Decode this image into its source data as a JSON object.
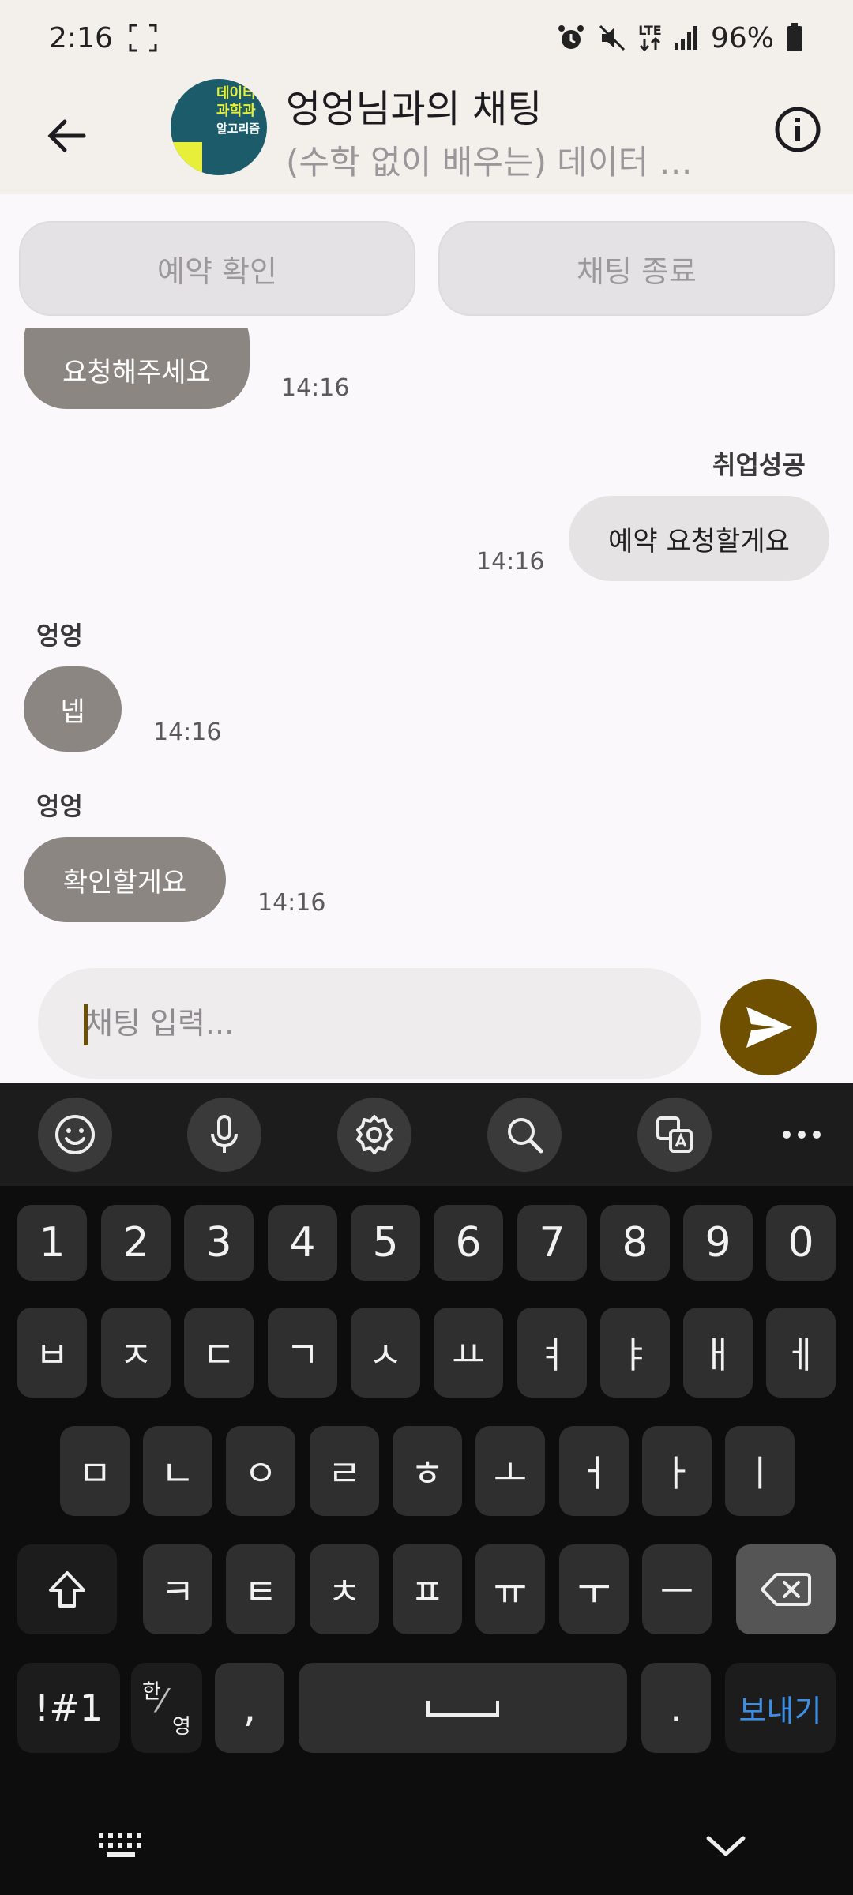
{
  "status_bar": {
    "time": "2:16",
    "network": "LTE",
    "battery": "96%",
    "icons": [
      "screenshot-frame-icon",
      "alarm-icon",
      "mute-icon",
      "lte-icon",
      "signal-icon",
      "battery-icon"
    ]
  },
  "header": {
    "title": "엉엉님과의 채팅",
    "subtitle": "(수학 없이 배우는) 데이터 …",
    "avatar_lines": [
      "데이터",
      "과학과",
      "알고리즘"
    ],
    "icons": [
      "back-arrow-icon",
      "info-icon"
    ]
  },
  "actions": {
    "confirm_reservation": "예약 확인",
    "end_chat": "채팅 종료"
  },
  "messages": [
    {
      "direction": "in",
      "sender": "",
      "text": "요청해주세요",
      "time": "14:16"
    },
    {
      "direction": "out",
      "sender": "취업성공",
      "text": "예약 요청할게요",
      "time": "14:16"
    },
    {
      "direction": "in",
      "sender": "엉엉",
      "text": "넵",
      "time": "14:16"
    },
    {
      "direction": "in",
      "sender": "엉엉",
      "text": "확인할게요",
      "time": "14:16"
    }
  ],
  "composer": {
    "placeholder": "채팅 입력...",
    "value": ""
  },
  "keyboard": {
    "toolbar_icons": [
      "emoji-icon",
      "microphone-icon",
      "settings-icon",
      "search-icon",
      "translate-icon",
      "more-icon"
    ],
    "row_numbers": [
      "1",
      "2",
      "3",
      "4",
      "5",
      "6",
      "7",
      "8",
      "9",
      "0"
    ],
    "row1": [
      "ㅂ",
      "ㅈ",
      "ㄷ",
      "ㄱ",
      "ㅅ",
      "ㅛ",
      "ㅕ",
      "ㅑ",
      "ㅐ",
      "ㅔ"
    ],
    "row2": [
      "ㅁ",
      "ㄴ",
      "ㅇ",
      "ㄹ",
      "ㅎ",
      "ㅗ",
      "ㅓ",
      "ㅏ",
      "ㅣ"
    ],
    "row3": [
      "ㅋ",
      "ㅌ",
      "ㅊ",
      "ㅍ",
      "ㅠ",
      "ㅜ",
      "ㅡ"
    ],
    "symbols_label": "!#1",
    "lang_top": "한",
    "lang_bottom": "영",
    "comma": ",",
    "period": ".",
    "enter_label": "보내기",
    "nav_icons": [
      "keyboard-icon",
      "hide-keyboard-icon"
    ]
  },
  "colors": {
    "header_bg": "#f3f0eb",
    "incoming_bubble": "#8c8683",
    "outgoing_bubble": "#e6e3e4",
    "send_button": "#6f4f00",
    "keyboard_bg": "#0d0d0d",
    "enter_text": "#3d8fe6"
  }
}
